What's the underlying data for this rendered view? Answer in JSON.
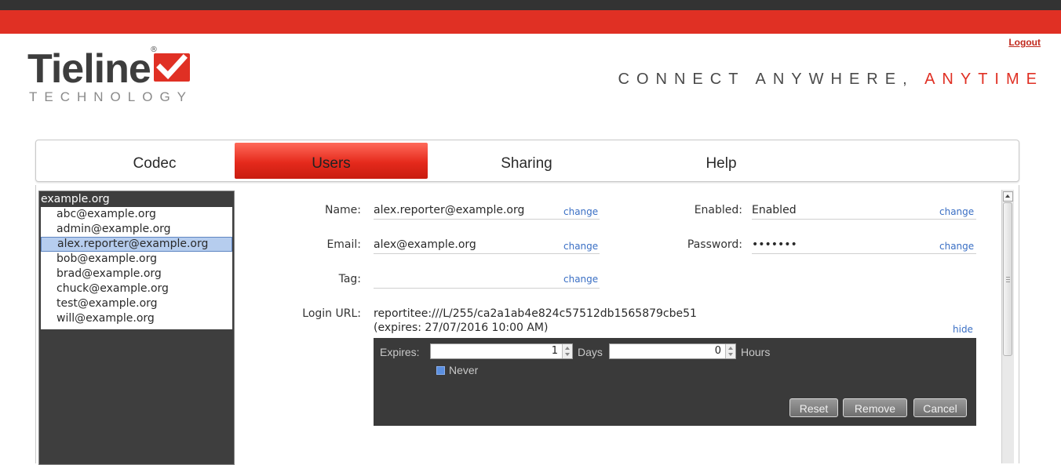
{
  "header": {
    "logout_label": "Logout",
    "logo_text": "Tieline",
    "logo_sub": "TECHNOLOGY",
    "logo_registered": "®",
    "tagline_part1": "CONNECT ANYWHERE,",
    "tagline_part2": "ANYTIME",
    "brand_color": "#e03024"
  },
  "tabs": [
    {
      "label": "Codec",
      "active": false
    },
    {
      "label": "Users",
      "active": true
    },
    {
      "label": "Sharing",
      "active": false
    },
    {
      "label": "Help",
      "active": false
    }
  ],
  "sidebar": {
    "domain": "example.org",
    "users": [
      "abc@example.org",
      "admin@example.org",
      "alex.reporter@example.org",
      "bob@example.org",
      "brad@example.org",
      "chuck@example.org",
      "test@example.org",
      "will@example.org"
    ],
    "selected": "alex.reporter@example.org"
  },
  "details": {
    "name_label": "Name:",
    "name_value": "alex.reporter@example.org",
    "email_label": "Email:",
    "email_value": "alex@example.org",
    "tag_label": "Tag:",
    "tag_value": "",
    "enabled_label": "Enabled:",
    "enabled_value": "Enabled",
    "password_label": "Password:",
    "password_value": "•••••••",
    "change_label": "change",
    "login_url_label": "Login URL:",
    "login_url_value": "reportitee:///L/255/ca2a1ab4e824c57512db1565879cbe51",
    "login_url_expires": "(expires: 27/07/2016 10:00 AM)",
    "hide_label": "hide"
  },
  "expiry": {
    "expires_label": "Expires:",
    "days_value": "1",
    "days_label": "Days",
    "hours_value": "0",
    "hours_label": "Hours",
    "never_label": "Never",
    "never_checked": true,
    "reset_label": "Reset",
    "remove_label": "Remove",
    "cancel_label": "Cancel"
  }
}
